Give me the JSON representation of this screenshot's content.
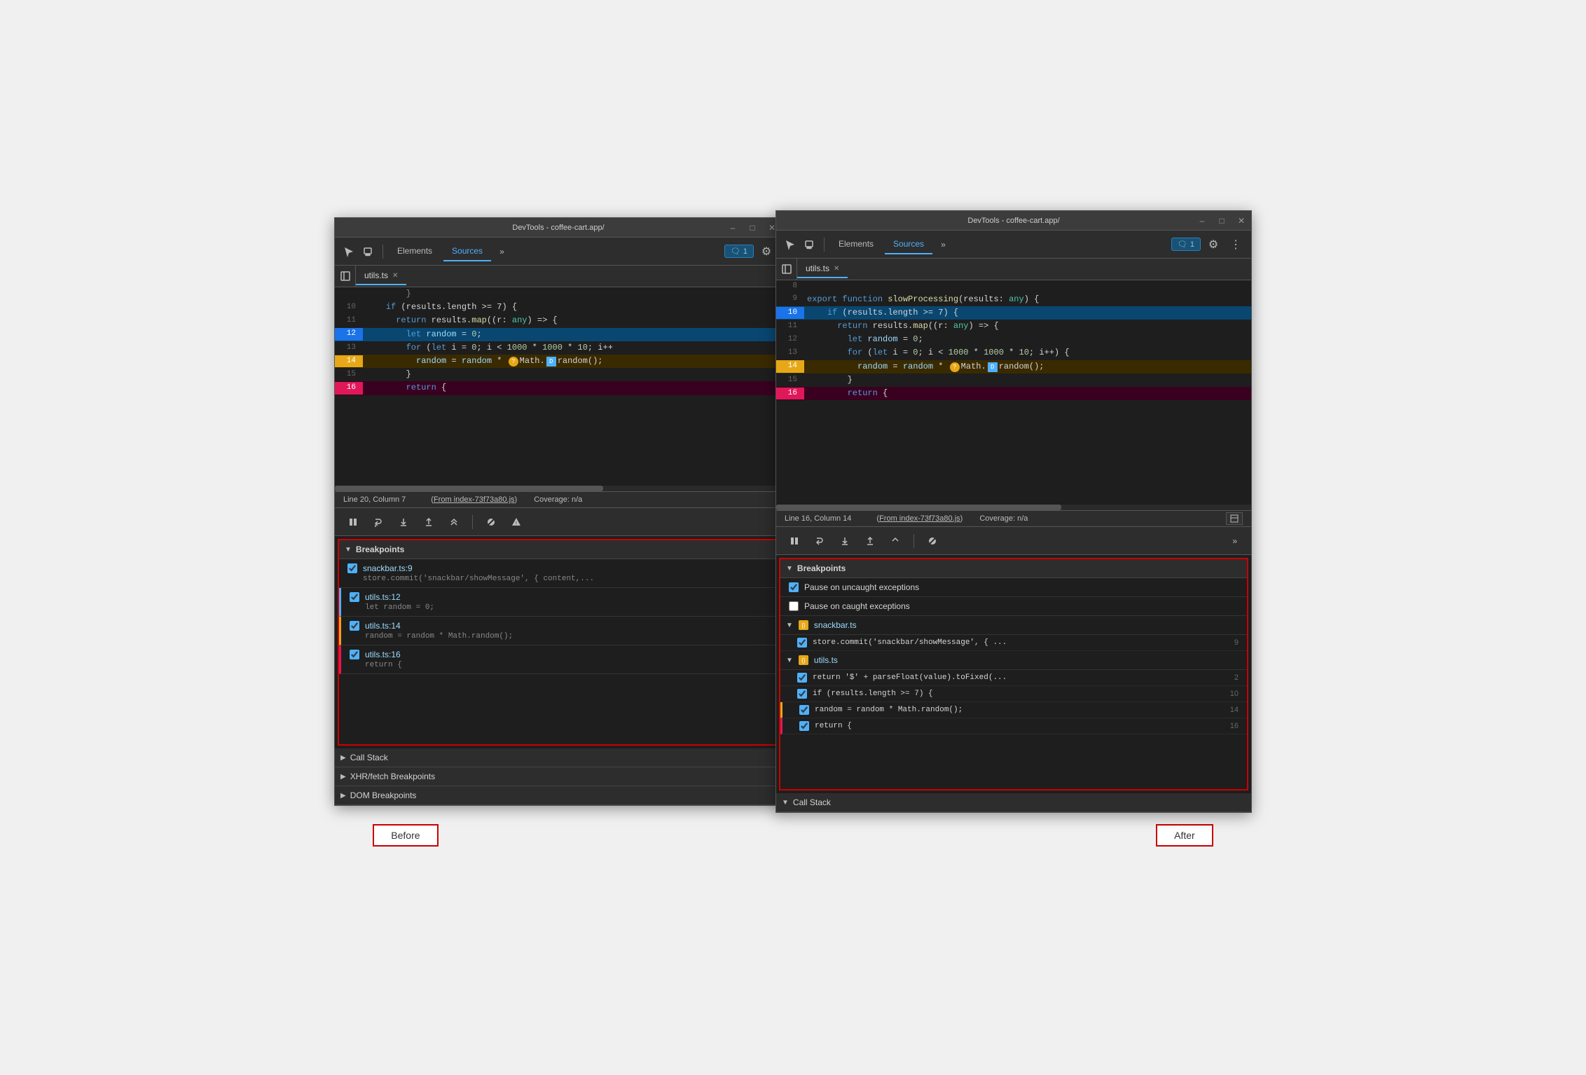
{
  "window": {
    "title": "DevTools - coffee-cart.app/",
    "controls": [
      "minimize",
      "maximize",
      "close"
    ]
  },
  "left_panel": {
    "title": "DevTools - coffee-cart.app/",
    "tabs": [
      "Elements",
      "Sources"
    ],
    "active_tab": "Sources",
    "badge": "1",
    "file_tab": "utils.ts",
    "code_lines": [
      {
        "num": 10,
        "content": "    if (results.length >= 7) {",
        "highlight": "none"
      },
      {
        "num": 11,
        "content": "      return results.map((r: any) => {",
        "highlight": "none"
      },
      {
        "num": 12,
        "content": "        let random = 0;",
        "highlight": "blue"
      },
      {
        "num": 13,
        "content": "        for (let i = 0; i < 1000 * 1000 * 10; i++",
        "highlight": "none"
      },
      {
        "num": 14,
        "content": "          random = random * ?Math.Drandom();",
        "highlight": "orange"
      },
      {
        "num": 15,
        "content": "        }",
        "highlight": "none"
      },
      {
        "num": 16,
        "content": "        return {",
        "highlight": "pink"
      }
    ],
    "status_line": "Line 20, Column 7",
    "status_from": "From index-73f73a80.js",
    "status_coverage": "Coverage: n/a",
    "breakpoints_section": {
      "title": "Breakpoints",
      "items": [
        {
          "filename": "snackbar.ts:9",
          "code": "store.commit('snackbar/showMessage', { content,..."
        },
        {
          "filename": "utils.ts:12",
          "code": "let random = 0;"
        },
        {
          "filename": "utils.ts:14",
          "code": "random = random * Math.random();"
        },
        {
          "filename": "utils.ts:16",
          "code": "return {"
        }
      ]
    },
    "call_stack_label": "Call Stack",
    "xhr_label": "XHR/fetch Breakpoints",
    "dom_label": "DOM Breakpoints"
  },
  "right_panel": {
    "title": "DevTools - coffee-cart.app/",
    "tabs": [
      "Elements",
      "Sources"
    ],
    "active_tab": "Sources",
    "badge": "1",
    "file_tab": "utils.ts",
    "code_lines": [
      {
        "num": 8,
        "content": "",
        "highlight": "none"
      },
      {
        "num": 9,
        "content": "export function slowProcessing(results: any) {",
        "highlight": "none"
      },
      {
        "num": 10,
        "content": "    if (results.length >= 7) {",
        "highlight": "blue"
      },
      {
        "num": 11,
        "content": "      return results.map((r: any) => {",
        "highlight": "none"
      },
      {
        "num": 12,
        "content": "        let random = 0;",
        "highlight": "none"
      },
      {
        "num": 13,
        "content": "        for (let i = 0; i < 1000 * 1000 * 10; i++) {",
        "highlight": "none"
      },
      {
        "num": 14,
        "content": "          random = random * ?Math.Drandom();",
        "highlight": "orange"
      },
      {
        "num": 15,
        "content": "        }",
        "highlight": "none"
      },
      {
        "num": 16,
        "content": "        return {",
        "highlight": "pink"
      }
    ],
    "status_line": "Line 16, Column 14",
    "status_from": "From index-73f73a80.js",
    "status_coverage": "Coverage: n/a",
    "breakpoints_section": {
      "title": "Breakpoints",
      "pause_uncaught": "Pause on uncaught exceptions",
      "pause_caught": "Pause on caught exceptions",
      "groups": [
        {
          "name": "snackbar.ts",
          "items": [
            {
              "code": "store.commit('snackbar/showMessage', { ...",
              "line": "9"
            }
          ]
        },
        {
          "name": "utils.ts",
          "items": [
            {
              "code": "return '$' + parseFloat(value).toFixed(...",
              "line": "2"
            },
            {
              "code": "if (results.length >= 7) {",
              "line": "10"
            },
            {
              "code": "random = random * Math.random();",
              "line": "14"
            },
            {
              "code": "return {",
              "line": "16"
            }
          ]
        }
      ]
    },
    "call_stack_label": "Call Stack"
  },
  "labels": {
    "before": "Before",
    "after": "After"
  }
}
